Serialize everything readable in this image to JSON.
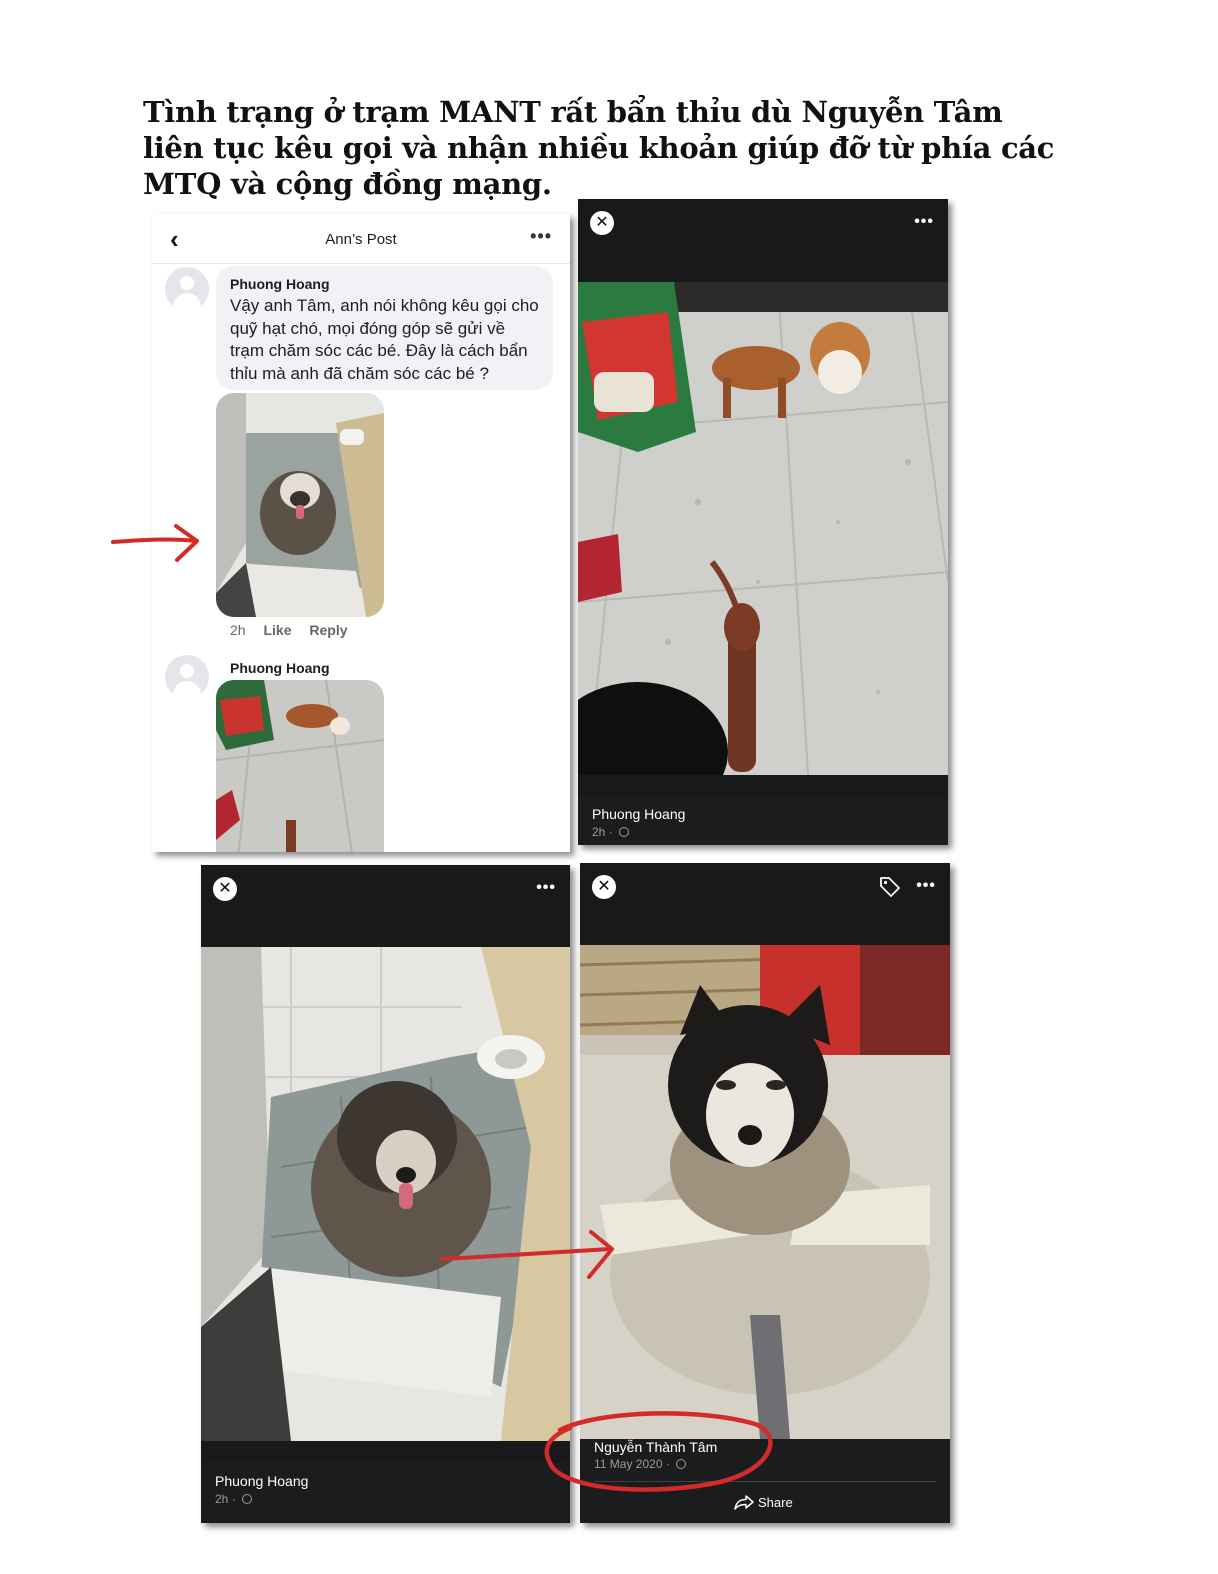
{
  "headline": "Tình trạng ở trạm MANT rất bẩn thỉu dù Nguyễn Tâm liên tục kêu gọi và nhận nhiều khoản giúp đỡ từ phía các MTQ và cộng đồng mạng.",
  "comments_panel": {
    "title": "Ann’s Post",
    "back_glyph": "‹",
    "more_glyph": "•••",
    "comment1": {
      "author": "Phuong Hoang",
      "text": "Vậy anh Tâm, anh nói không kêu gọi cho quỹ hạt chó, mọi đóng góp sẽ gửi về trạm chăm sóc các bé. Đây là cách bẩn thỉu mà anh đã chăm sóc các bé ?",
      "time": "2h",
      "like_label": "Like",
      "reply_label": "Reply"
    },
    "comment2": {
      "author": "Phuong Hoang"
    }
  },
  "viewer_top_right": {
    "close_glyph": "✕",
    "more_glyph": "•••",
    "author": "Phuong Hoang",
    "time": "2h",
    "dot": "·"
  },
  "viewer_bottom_left": {
    "close_glyph": "✕",
    "more_glyph": "•••",
    "author": "Phuong Hoang",
    "time": "2h",
    "dot": "·"
  },
  "viewer_bottom_right": {
    "close_glyph": "✕",
    "more_glyph": "•••",
    "author": "Nguyễn Thành Tâm",
    "date": "11 May 2020",
    "dot": "·",
    "share_label": "Share"
  },
  "annotation_color": "#d42a2a"
}
